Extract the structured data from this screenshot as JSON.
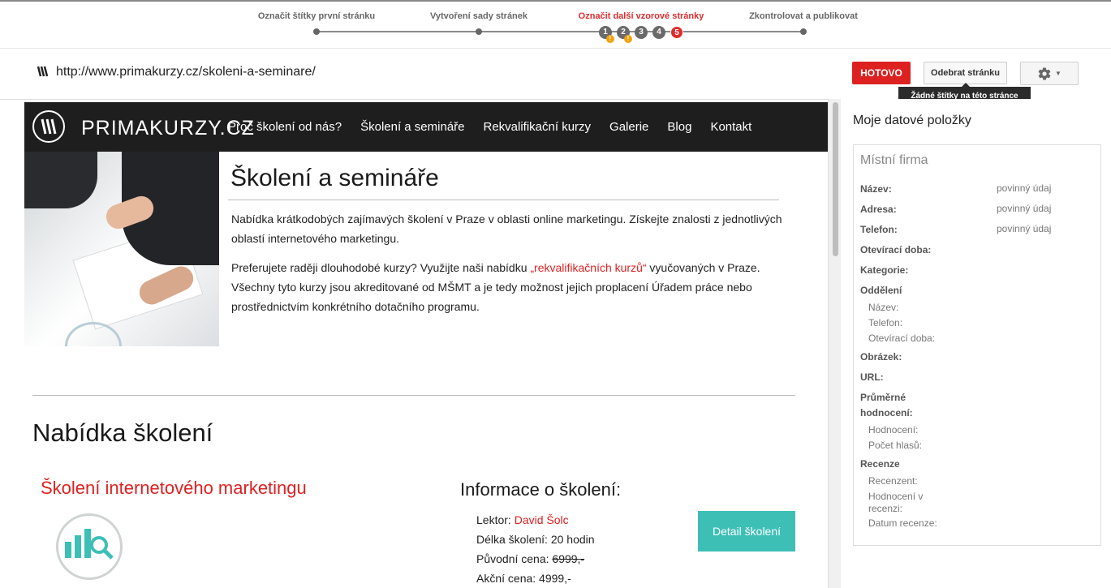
{
  "steps": {
    "labels": [
      "Označit štítky první stránku",
      "Vytvoření sady stránek",
      "Označit další vzorové stránky",
      "Zkontrolovat a publikovat"
    ],
    "sub_numbers": [
      "1",
      "2",
      "3",
      "4",
      "5"
    ],
    "warning_glyph": "!"
  },
  "urlbar": {
    "url": "http://www.primakurzy.cz/skoleni-a-seminare/",
    "done_label": "HOTOVO",
    "remove_label": "Odebrat stránku",
    "tooltip": "Žádné štítky na této stránce"
  },
  "site": {
    "brand": "PRIMAKURZY.CZ",
    "menu": [
      "Proč školení od nás?",
      "Školení a semináře",
      "Rekvalifikační kurzy",
      "Galerie",
      "Blog",
      "Kontakt"
    ],
    "title": "Školení a semináře",
    "para1": "Nabídka krátkodobých zajímavých školení v Praze v oblasti online marketingu. Získejte znalosti z jednotlivých oblastí internetového marketingu.",
    "para2_before": "Preferujete raději dlouhodobé kurzy? Využijte naši nabídku ",
    "para2_link": "„rekvalifikačních kurzů“",
    "para2_after": " vyučovaných v Praze. Všechny tyto kurzy jsou akreditované od MŠMT a je tedy možnost jejich proplacení Úřadem práce nebo prostřednictvím konkrétního dotačního programu.",
    "offer_heading": "Nabídka školení",
    "course_title": "Školení internetového marketingu",
    "info_title": "Informace o školení:",
    "lector_label": "Lektor: ",
    "lector_name": "David Šolc",
    "duration": "Délka školení: 20 hodin",
    "orig_price_label": "Původní cena: ",
    "orig_price": "6999,-",
    "sale_price": "Akční cena: 4999,-",
    "detail_button": "Detail školení"
  },
  "side": {
    "title": "Moje datové položky",
    "box_title": "Místní firma",
    "required": "povinný údaj",
    "fields": {
      "name": "Název:",
      "address": "Adresa:",
      "phone": "Telefon:",
      "hours": "Otevírací doba:",
      "category": "Kategorie:",
      "department": "Oddělení",
      "dept_name": "Název:",
      "dept_phone": "Telefon:",
      "dept_hours": "Otevírací doba:",
      "image": "Obrázek:",
      "url": "URL:",
      "avg_rating": "Průměrné hodnocení:",
      "rating": "Hodnocení:",
      "votes": "Počet hlasů:",
      "reviews": "Recenze",
      "reviewer": "Recenzent:",
      "review_rating": "Hodnocení v recenzi:",
      "review_date": "Datum recenze:"
    }
  },
  "colors": {
    "accent": "#dd2121",
    "teal": "#3dbfb6",
    "warning": "#f2a20b"
  }
}
